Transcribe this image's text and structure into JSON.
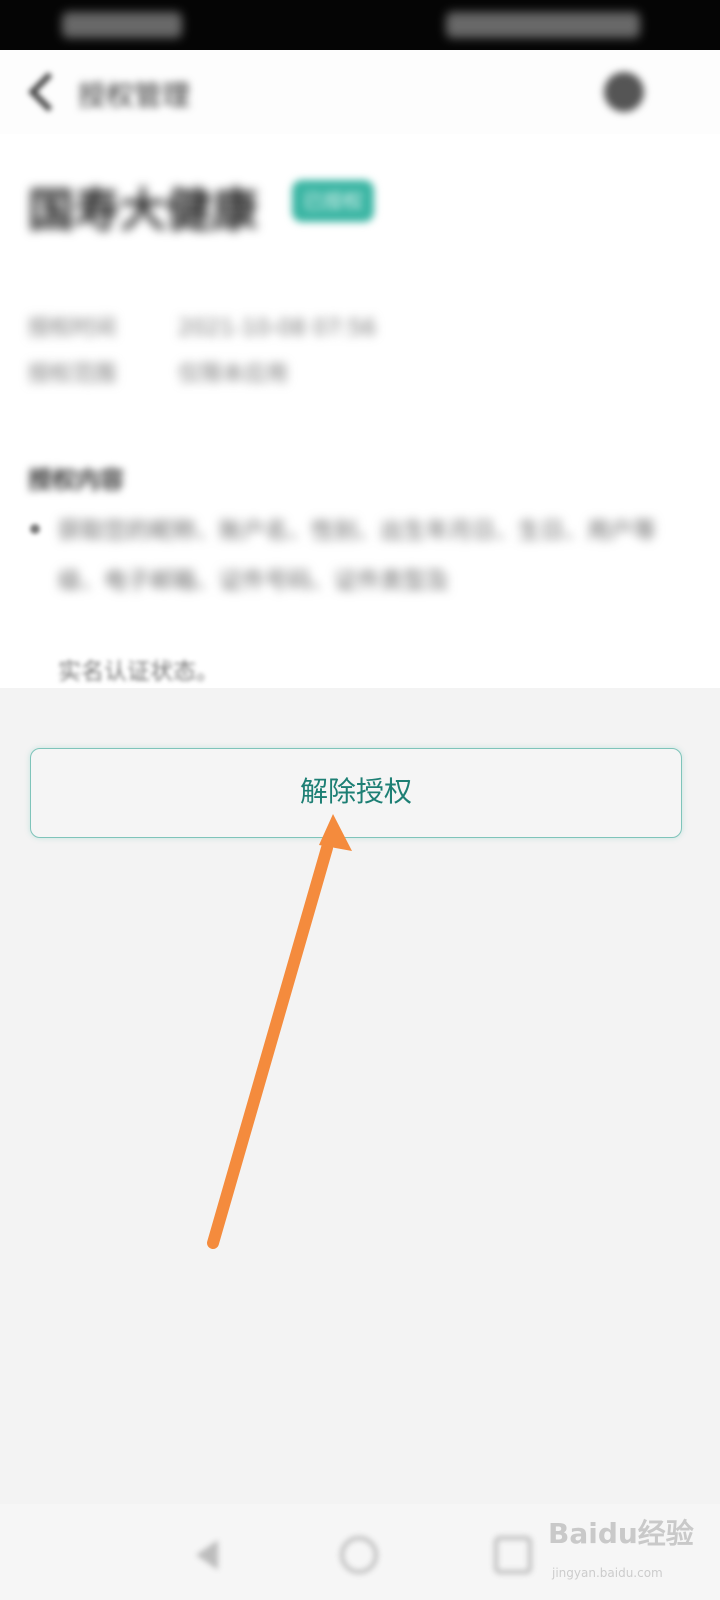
{
  "status_bar": {},
  "nav": {
    "title": "授权管理"
  },
  "app": {
    "name": "国寿大健康",
    "status": "已授权"
  },
  "info": {
    "auth_time_label": "授权时间",
    "auth_time_value": "2021-10-08 07:56",
    "auth_scope_label": "授权范围",
    "auth_scope_value": "仅限本应用"
  },
  "permissions": {
    "title": "授权内容",
    "item_text": "获取您的昵称、账户名、性别、出生年月日、生日、用户等级、电子邮箱、证件号码、证件类型及",
    "item_end": "实名认证状态。"
  },
  "actions": {
    "revoke_label": "解除授权"
  },
  "colors": {
    "accent": "#1d7f74",
    "button_border": "#7fc4ba",
    "tag": "#3ab5a3",
    "arrow": "#f48b3d"
  },
  "icons": {
    "back": "chevron-left-icon",
    "settings": "settings-icon",
    "nav_back": "triangle-back-icon",
    "nav_home": "circle-home-icon",
    "nav_recent": "square-recent-icon"
  },
  "watermark": {
    "brand": "Baidu经验",
    "url": "jingyan.baidu.com"
  }
}
